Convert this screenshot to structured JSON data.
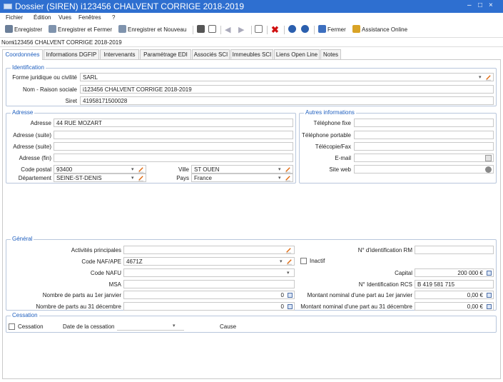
{
  "window": {
    "title": "Dossier (SIREN) i123456 CHALVENT CORRIGE 2018-2019",
    "minimize": "–",
    "maximize": "□",
    "close": "×"
  },
  "menu": [
    "Fichier",
    "Édition",
    "Vues",
    "Fenêtres",
    "?"
  ],
  "toolbar": {
    "save": "Enregistrer",
    "save_close": "Enregistrer et Fermer",
    "save_new": "Enregistrer et Nouveau",
    "close": "Fermer",
    "assistance": "Assistance Online"
  },
  "namebar": {
    "label": "Nom",
    "value": "i123456 CHALVENT CORRIGE 2018-2019"
  },
  "tabs": [
    "Coordonnées",
    "Informations DGFIP",
    "Intervenants",
    "Paramétrage EDI",
    "Associés SCI",
    "Immeubles SCI",
    "Liens Open Line",
    "Notes"
  ],
  "identification": {
    "title": "Identification",
    "forme_label": "Forme juridique ou civilité",
    "forme_value": "SARL",
    "nom_label": "Nom - Raison sociale",
    "nom_value": "i123456 CHALVENT CORRIGE 2018-2019",
    "siret_label": "Siret",
    "siret_value": "41958171500028"
  },
  "adresse": {
    "title": "Adresse",
    "adresse_label": "Adresse",
    "adresse_value": "44 RUE MOZART",
    "suite1_label": "Adresse (suite)",
    "suite2_label": "Adresse (suite)",
    "fin_label": "Adresse (fin)",
    "cp_label": "Code postal",
    "cp_value": "93400",
    "ville_label": "Ville",
    "ville_value": "ST OUEN",
    "dept_label": "Département",
    "dept_value": "SEINE-ST-DENIS",
    "pays_label": "Pays",
    "pays_value": "France"
  },
  "autres": {
    "title": "Autres informations",
    "tel_fixe": "Téléphone fixe",
    "tel_port": "Téléphone portable",
    "fax": "Télécopie/Fax",
    "email": "E-mail",
    "site": "Site web"
  },
  "general": {
    "title": "Général",
    "activites_label": "Activités principales",
    "naf_label": "Code NAF/APE",
    "naf_value": "4671Z",
    "nafu_label": "Code NAFU",
    "msa_label": "MSA",
    "parts1_label": "Nombre de parts au 1er janvier",
    "parts1_value": "0",
    "parts31_label": "Nombre de parts au 31 décembre",
    "parts31_value": "0",
    "rm_label": "N° d'identification RM",
    "inactif_label": "Inactif",
    "capital_label": "Capital",
    "capital_value": "200 000 €",
    "rcs_label": "N° Identification RCS",
    "rcs_value": "B 419 581 715",
    "nominal1_label": "Montant nominal d'une part au 1er janvier",
    "nominal1_value": "0,00 €",
    "nominal31_label": "Montant nominal d'une part au 31 décembre",
    "nominal31_value": "0,00 €"
  },
  "cessation": {
    "title": "Cessation",
    "cb_label": "Cessation",
    "date_label": "Date de la cessation",
    "cause_label": "Cause"
  },
  "colors": {
    "titlebar": "#2e6fd0",
    "accent": "#1f5fbf",
    "group_border": "#b8c6dc"
  }
}
